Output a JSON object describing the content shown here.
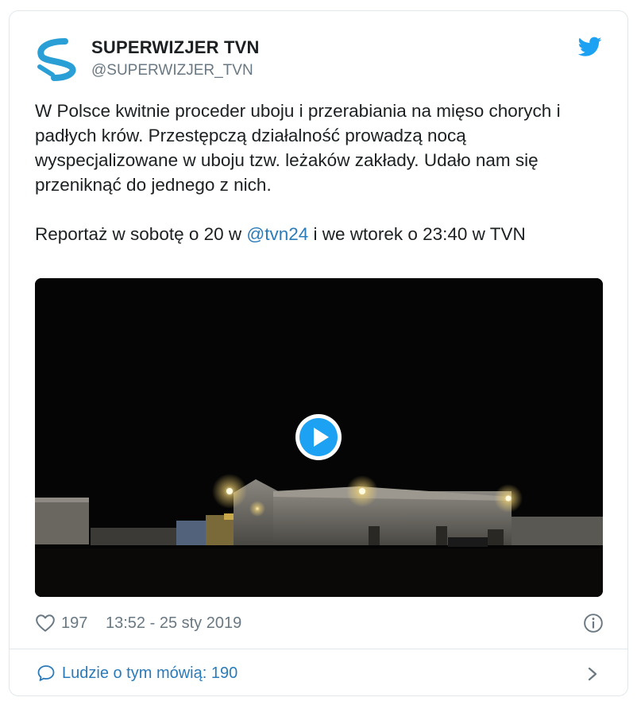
{
  "account": {
    "name": "SUPERWIZJER TVN",
    "handle": "@SUPERWIZJER_TVN"
  },
  "tweet": {
    "paragraph1": "W Polsce kwitnie proceder uboju i przerabiania na mięso chorych i padłych krów. Przestępczą działalność prowadzą nocą wyspecjalizowane w uboju tzw. leżaków zakłady. Udało nam się przeniknąć do jednego z nich.",
    "paragraph2_before": "Reportaż w sobotę o 20 w ",
    "mention": "@tvn24",
    "paragraph2_after": " i we wtorek o 23:40 w TVN"
  },
  "footer": {
    "likes": "197",
    "timestamp": "13:52 - 25 sty 2019"
  },
  "conversation": {
    "label": "Ludzie o tym mówią: 190"
  },
  "icons": {
    "brand": "twitter-bird-icon",
    "like": "heart-icon",
    "info": "info-icon",
    "reply": "speech-bubble-icon",
    "chevron": "chevron-right-icon",
    "play": "play-icon"
  },
  "colors": {
    "link": "#2b7bb9",
    "twitter_blue": "#1da1f2",
    "muted": "#697882",
    "text": "#1c2022",
    "border": "#e1e8ed"
  }
}
